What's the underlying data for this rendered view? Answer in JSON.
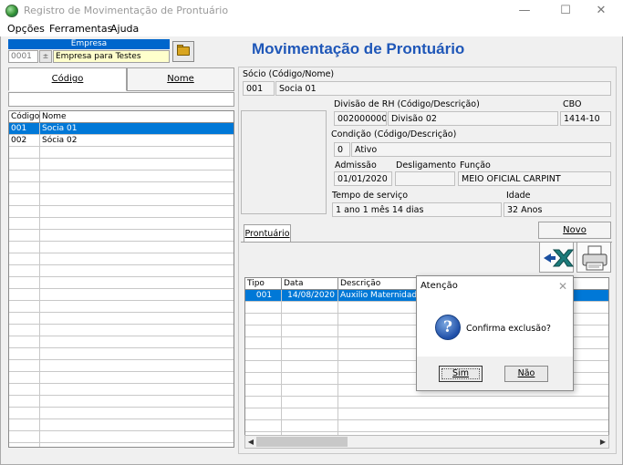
{
  "window": {
    "title": "Registro de Movimentação de Prontuário",
    "controls": [
      "—",
      "☐",
      "✕"
    ]
  },
  "menu": [
    "Opções",
    "Ferramentas",
    "Ajuda"
  ],
  "empresa": {
    "header": "Empresa",
    "code": "0001",
    "name": "Empresa para Testes"
  },
  "page_title": "Movimentação de Prontuário",
  "left": {
    "sort_codigo": "Código",
    "sort_nome": "Nome",
    "columns": [
      "Código",
      "Nome"
    ],
    "rows": [
      {
        "codigo": "001",
        "nome": "Socia 01",
        "selected": true
      },
      {
        "codigo": "002",
        "nome": "Sócia 02",
        "selected": false
      }
    ]
  },
  "socio": {
    "label": "Sócio (Código/Nome)",
    "code": "001",
    "name": "Socia 01"
  },
  "divisao": {
    "label": "Divisão de RH (Código/Descrição)",
    "code": "002000000",
    "desc": "Divisão 02"
  },
  "cbo": {
    "label": "CBO",
    "value": "1414-10"
  },
  "condicao": {
    "label": "Condição (Código/Descrição)",
    "code": "0",
    "desc": "Ativo"
  },
  "admissao": {
    "label": "Admissão",
    "value": "01/01/2020"
  },
  "desligamento": {
    "label": "Desligamento",
    "value": ""
  },
  "funcao": {
    "label": "Função",
    "value": "MEIO OFICIAL CARPINT"
  },
  "tempo_servico": {
    "label": "Tempo de serviço",
    "value": "1 ano 1 mês 14 dias"
  },
  "idade": {
    "label": "Idade",
    "value": "32 Anos"
  },
  "tab_prontuario": "Prontuário",
  "novo_label": "Novo",
  "prontuario": {
    "columns": [
      "Tipo",
      "Data",
      "Descrição"
    ],
    "rows": [
      {
        "tipo": "001",
        "data": "14/08/2020",
        "descricao": "Auxilio Maternidade",
        "selected": true
      }
    ]
  },
  "dialog": {
    "title": "Atenção",
    "message": "Confirma exclusão?",
    "yes": "Sim",
    "no": "Não",
    "close": "✕",
    "icon_glyph": "?"
  },
  "icons": {
    "app": "app-icon",
    "folder": "folder-open-icon",
    "delete": "delete-x-icon",
    "print": "printer-icon",
    "question": "question-icon"
  }
}
